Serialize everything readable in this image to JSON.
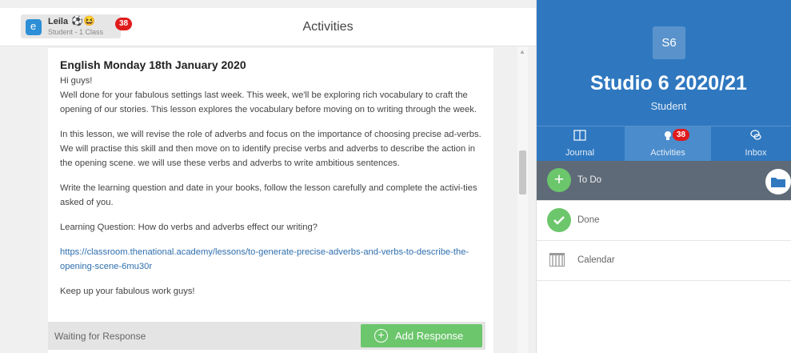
{
  "header": {
    "user_name": "Leila",
    "user_emoji": "⚽😆",
    "user_role": "Student - 1 Class",
    "notification_count": "38",
    "page_title": "Activities"
  },
  "post": {
    "title": "English Monday 18th January 2020",
    "greeting": "Hi guys!",
    "paragraph_1": "Well done for your fabulous settings last week. This week, we'll be exploring rich vocabulary to craft the opening of our stories. This lesson explores the vocabulary before moving on to writing through the week.",
    "paragraph_2": "In this lesson, we will revise the role of adverbs and focus on the importance of choosing precise ad-verbs. We will practise this skill and then move on to identify precise verbs and adverbs to describe the action in the opening scene. we will use these verbs and adverbs to write ambitious sentences.",
    "paragraph_3": "Write the learning question and date in your books, follow the lesson carefully and complete the activi-ties asked of you.",
    "learning_question": "Learning Question: How do verbs and adverbs effect our writing?",
    "link": "https://classroom.thenational.academy/lessons/to-generate-precise-adverbs-and-verbs-to-describe-the-opening-scene-6mu30r",
    "closing": "Keep up your fabulous work guys!"
  },
  "response": {
    "status": "Waiting for Response",
    "add_label": "Add Response"
  },
  "sidebar": {
    "badge": "S6",
    "title": "Studio 6 2020/21",
    "subtitle": "Student",
    "tabs": [
      {
        "label": "Journal",
        "icon": "book-icon"
      },
      {
        "label": "Activities",
        "icon": "lightbulb-icon",
        "badge": "38"
      },
      {
        "label": "Inbox",
        "icon": "chat-bubbles-icon"
      }
    ],
    "menu": [
      {
        "label": "To Do",
        "icon": "plus-circle-icon"
      },
      {
        "label": "Done",
        "icon": "check-circle-icon"
      },
      {
        "label": "Calendar",
        "icon": "calendar-icon"
      }
    ]
  },
  "colors": {
    "brand_blue": "#2f78c0",
    "active_tab": "#4a8ccc",
    "todo_row": "#5e6a77",
    "green": "#6cc66c",
    "badge_red": "#e01b1b"
  }
}
